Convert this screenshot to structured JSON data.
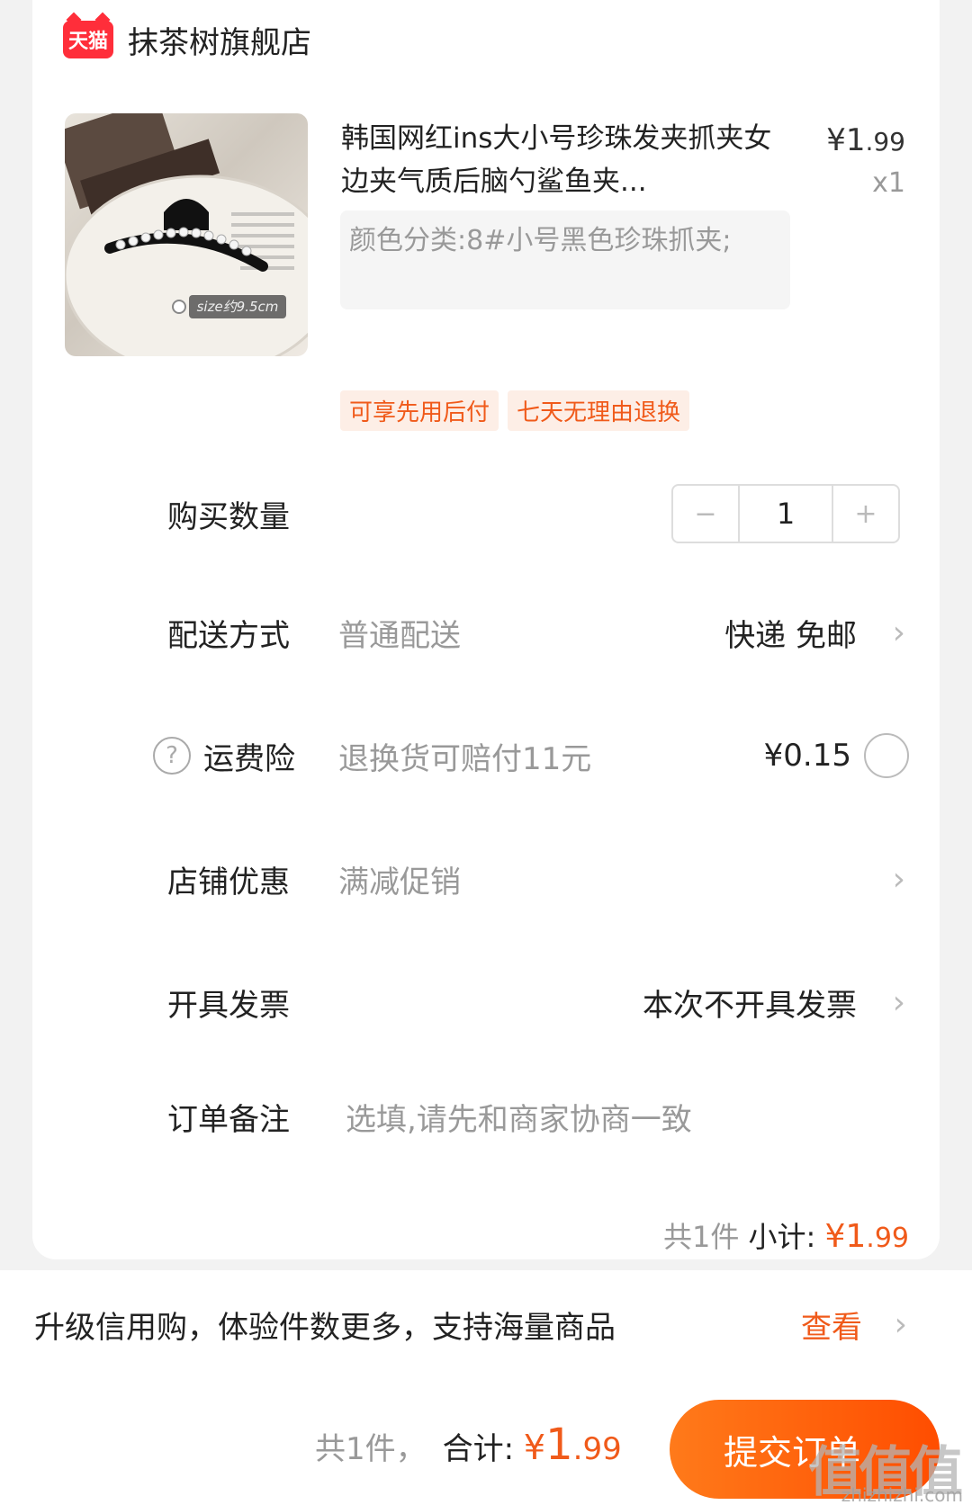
{
  "store": {
    "badge": "天猫",
    "name": "抹茶树旗舰店"
  },
  "product": {
    "image_label": "size约9.5cm",
    "title": "韩国网红ins大小号珍珠发夹抓夹女边夹气质后脑勺鲨鱼夹...",
    "price_symbol": "¥",
    "price_int": "1",
    "price_dec": ".99",
    "qty": "x1",
    "spec": "颜色分类:8#小号黑色珍珠抓夹;",
    "tags": [
      "可享先用后付",
      "七天无理由退换"
    ]
  },
  "rows": {
    "quantity": {
      "label": "购买数量",
      "minus": "−",
      "value": "1",
      "plus": "+"
    },
    "delivery": {
      "label": "配送方式",
      "sub": "普通配送",
      "value": "快递 免邮"
    },
    "insurance": {
      "icon": "?",
      "label": "运费险",
      "sub": "退换货可赔付11元",
      "value": "¥0.15"
    },
    "discount": {
      "label": "店铺优惠",
      "sub": "满减促销"
    },
    "invoice": {
      "label": "开具发票",
      "value": "本次不开具发票"
    },
    "note": {
      "label": "订单备注",
      "placeholder": "选填,请先和商家协商一致"
    }
  },
  "chevron": "›",
  "subtotal": {
    "count": "共1件",
    "label": "小计:",
    "symbol": "¥",
    "int": "1",
    "dec": ".99"
  },
  "banner": {
    "text": "升级信用购，体验件数更多，支持海量商品",
    "link": "查看"
  },
  "bottom": {
    "count": "共1件，",
    "label": "合计:",
    "symbol": "¥",
    "int": "1",
    "dec": ".99",
    "submit": "提交订单",
    "watermark": "值值值",
    "watermark_url": "zhizhizhi.com"
  },
  "colors": {
    "accent": "#f05a1a",
    "button": "#ff5a0a",
    "tmall": "#ff2e3a"
  }
}
